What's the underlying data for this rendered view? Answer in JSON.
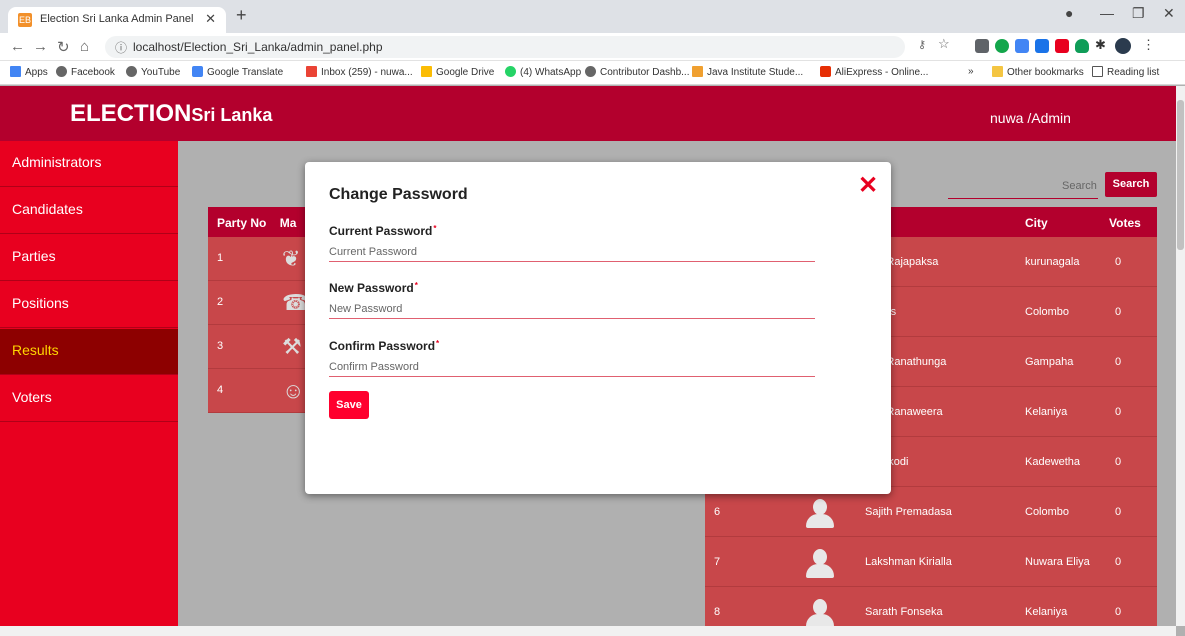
{
  "browser": {
    "tab_title": "Election Sri Lanka Admin Panel",
    "favicon_text": "EB",
    "url": "localhost/Election_Sri_Lanka/admin_panel.php",
    "bookmarks": [
      "Apps",
      "Facebook",
      "YouTube",
      "Google Translate",
      "Inbox (259) - nuwa...",
      "Google Drive",
      "(4) WhatsApp",
      "Contributor Dashb...",
      "Java Institute Stude...",
      "AliExpress - Online..."
    ],
    "other_bookmarks": "Other bookmarks",
    "reading_list": "Reading list",
    "more_bookmarks": "»"
  },
  "header": {
    "brand_main": "ELECTION",
    "brand_sub": "Sri Lanka",
    "user": "nuwa /Admin"
  },
  "sidebar": {
    "items": [
      {
        "label": "Administrators"
      },
      {
        "label": "Candidates"
      },
      {
        "label": "Parties"
      },
      {
        "label": "Positions"
      },
      {
        "label": "Results"
      },
      {
        "label": "Voters"
      }
    ],
    "active": "Results"
  },
  "search": {
    "placeholder": "Search",
    "button": "Search"
  },
  "party_table": {
    "headers": [
      "Party No",
      "Ma"
    ],
    "rows": [
      "1",
      "2",
      "3",
      "4"
    ]
  },
  "candidate_table": {
    "headers": {
      "name": "e",
      "city": "City",
      "votes": "Votes"
    },
    "rows": [
      {
        "no": "",
        "name": "nda Rajapaksa",
        "city": "kurunagala",
        "votes": "0"
      },
      {
        "no": "",
        "name": "Peries",
        "city": "Colombo",
        "votes": "0"
      },
      {
        "no": "",
        "name": "nna Ranathunga",
        "city": "Gampaha",
        "votes": "0"
      },
      {
        "no": "",
        "name": "nna Ranaweera",
        "city": "Kelaniya",
        "votes": "0"
      },
      {
        "no": "",
        "name": "Jayakodi",
        "city": "Kadewetha",
        "votes": "0"
      },
      {
        "no": "6",
        "name": "Sajith Premadasa",
        "city": "Colombo",
        "votes": "0"
      },
      {
        "no": "7",
        "name": "Lakshman Kirialla",
        "city": "Nuwara Eliya",
        "votes": "0"
      },
      {
        "no": "8",
        "name": "Sarath Fonseka",
        "city": "Kelaniya",
        "votes": "0"
      }
    ]
  },
  "modal": {
    "title": "Change Password",
    "close": "✕",
    "current_label": "Current Password",
    "current_placeholder": "Current Password",
    "new_label": "New Password",
    "new_placeholder": "New Password",
    "confirm_label": "Confirm Password",
    "confirm_placeholder": "Confirm Password",
    "required_mark": "*",
    "save": "Save"
  },
  "colors": {
    "brand": "#b3002d",
    "sidebar": "#e8001f",
    "active_bg": "#8d0000",
    "active_text": "#ffd400",
    "row_bg": "#c8474a"
  }
}
